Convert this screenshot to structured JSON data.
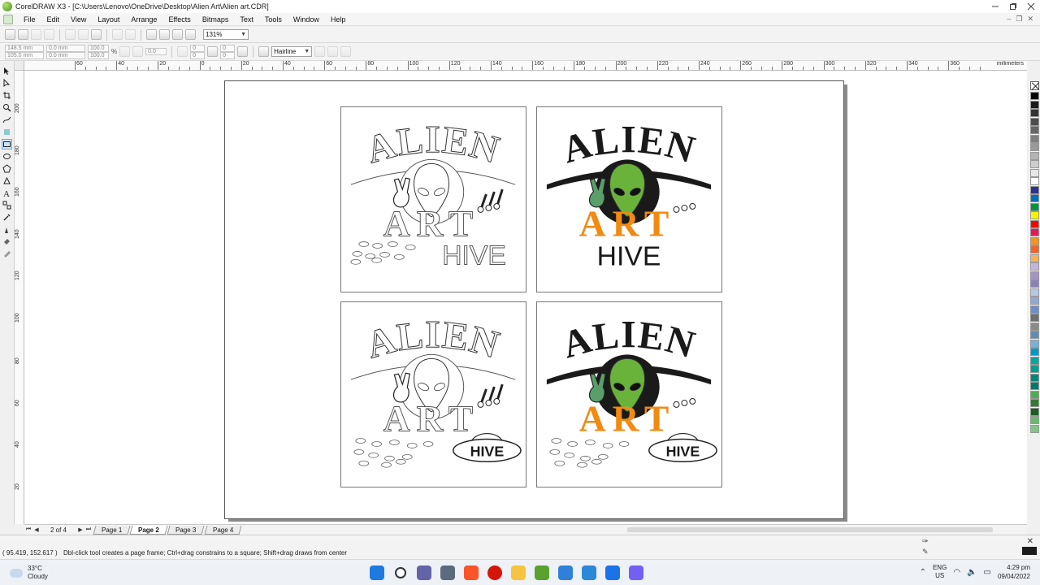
{
  "window": {
    "title": "CorelDRAW X3 - [C:\\Users\\Lenovo\\OneDrive\\Desktop\\Alien Art\\Alien art.CDR]"
  },
  "menu": {
    "items": [
      "File",
      "Edit",
      "View",
      "Layout",
      "Arrange",
      "Effects",
      "Bitmaps",
      "Text",
      "Tools",
      "Window",
      "Help"
    ]
  },
  "toolbar": {
    "zoom": "131%"
  },
  "property_bar": {
    "x": "148.5 mm",
    "y": "105.0 mm",
    "w": "0.0 mm",
    "h": "0.0 mm",
    "scale_x": "100.0",
    "scale_y": "100.0",
    "pct": "%",
    "angle": "0.0",
    "corner1": "0",
    "corner2": "0",
    "corner3": "0",
    "corner4": "0",
    "outline": "Hairline"
  },
  "ruler": {
    "units": "millimeters",
    "h_labels": [
      "60",
      "40",
      "20",
      "0",
      "20",
      "40",
      "60",
      "80",
      "100",
      "120",
      "140",
      "160",
      "180",
      "200",
      "220",
      "240",
      "260",
      "280",
      "300",
      "320",
      "340",
      "360"
    ],
    "v_labels": [
      "200",
      "180",
      "160",
      "140",
      "120",
      "100",
      "80",
      "60",
      "40",
      "20"
    ],
    "v_units": "millimeters"
  },
  "artwork": {
    "word_top": "ALIEN",
    "word_mid": "ART",
    "word_hive": "HIVE"
  },
  "palette": {
    "colors": [
      "#000000",
      "#1a1a1a",
      "#333333",
      "#4d4d4d",
      "#666666",
      "#808080",
      "#999999",
      "#b3b3b3",
      "#cccccc",
      "#e6e6e6",
      "#ffffff",
      "#2e3192",
      "#0071bc",
      "#009245",
      "#fff200",
      "#ff0000",
      "#ed145b",
      "#f7941d",
      "#f26522",
      "#fbaf5d",
      "#c4b5e0",
      "#a393c7",
      "#8781bd",
      "#b8c7e8",
      "#8fa8d6",
      "#6d8ec9",
      "#6e6e6e",
      "#8a8a8a",
      "#5f8db8",
      "#7bb1d9",
      "#0099cc",
      "#00a99d",
      "#009e8f",
      "#00897b",
      "#00796b",
      "#4caf50",
      "#2e7d32",
      "#1b5e20",
      "#66bb6a",
      "#81c784"
    ]
  },
  "docnav": {
    "page_count": "2 of 4",
    "tabs": [
      "Page 1",
      "Page 2",
      "Page 3",
      "Page 4"
    ],
    "active_tab": "Page 2"
  },
  "status": {
    "coords": "( 95.419, 152.617 )",
    "hint": "Dbl-click tool creates a page frame; Ctrl+drag constrains to a square; Shift+drag draws from center"
  },
  "taskbar": {
    "temp": "33°C",
    "condition": "Cloudy",
    "lang1": "ENG",
    "lang2": "US",
    "time": "4:29 pm",
    "date": "09/04/2022",
    "icons": [
      "windows-start",
      "search",
      "teams-chat",
      "file-explorer-cursor",
      "brave",
      "record",
      "folder",
      "coreldraw",
      "azure",
      "check",
      "bitdefender",
      "viber"
    ]
  }
}
